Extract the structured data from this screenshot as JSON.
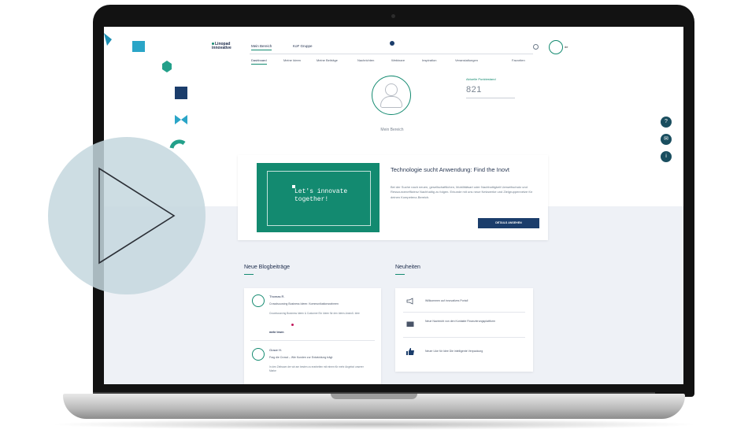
{
  "header": {
    "logo_line1": "Linopad",
    "logo_line2": "innovative",
    "tabs": [
      {
        "label": "Mein Bereich"
      },
      {
        "label": "KoF Gruppe"
      }
    ],
    "badge_count": "",
    "user_name": "de"
  },
  "subnav": [
    "Dashboard",
    "Meine Ideen",
    "Meine Beiträge",
    "Nachrichten",
    "Webinare",
    "Inspiration",
    "Veranstaltungen",
    "Favoriten"
  ],
  "profile": {
    "title": "Mein Bereich",
    "count_label": "Aktuelle Punktestand",
    "count_value": "821"
  },
  "hero": {
    "green_text": "Let's innovate together!",
    "title": "Technologie sucht Anwendung: Find the Inovt",
    "body": "Bei der Suche nach neuen, gesellschaftlichen, Mobilitätsart oder Nachhaltigkeit Umweltschutz und Ressourceneffizienz Nachhaltig zu folgen. Erkunde mit uns neue Netzwerke und Zielgruppennetze für deinen Kompetenz-Bereich.",
    "button": "DETAILS ANSEHEN"
  },
  "blog": {
    "title": "Neue Blogbeiträge",
    "posts": [
      {
        "name": "Thomas R.",
        "subject": "Crowdsourcing Business Ideen: Kommunikationsrahmen",
        "text": "Crowdsourcing Business Ideen & Customer Ein Ideen für den Ideen-Anstoß. Idee",
        "more": "mehr lesen"
      },
      {
        "name": "Grace H.",
        "subject": "Frag die Crowd – Wie Kunden zur Entwicklung trägt",
        "text": "In den Zeitraum der wir am besten zu erarbeiten mit einem für mehr Angebot unserer Marke"
      }
    ]
  },
  "news": {
    "title": "Neuheiten",
    "items": [
      {
        "text": "Willkommen auf innovatives Portal!",
        "icon": "megaphone-icon"
      },
      {
        "text": "Neue Nachricht von den Kontakte Finanzierungsplattform",
        "icon": "chat-icon"
      },
      {
        "text": "Neuer Like für Idee Die intelligente Verpackung",
        "icon": "thumbs-up-icon"
      }
    ]
  },
  "colors": {
    "accent_green": "#138a70",
    "navy": "#1b3d6b",
    "side_button": "#1a4e5f",
    "overlay": "#c4d7de"
  }
}
